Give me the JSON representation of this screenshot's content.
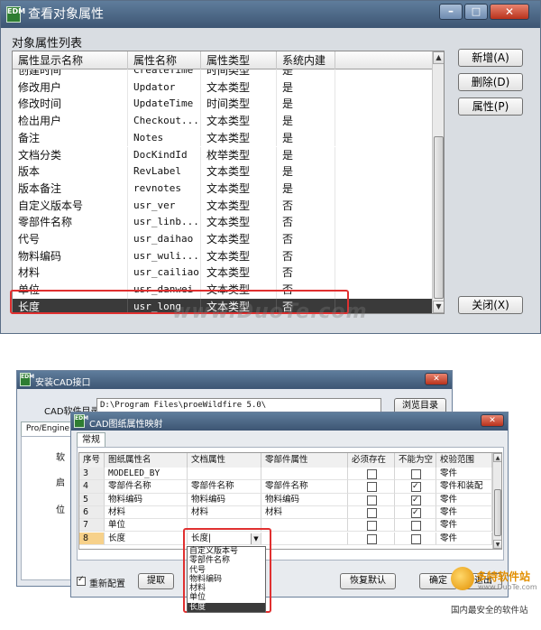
{
  "win1": {
    "logo": "EDM",
    "title": "查看对象属性",
    "list_label": "对象属性列表",
    "columns": [
      "属性显示名称",
      "属性名称",
      "属性类型",
      "系统内建"
    ],
    "rows": [
      [
        "创建时间",
        "CreateTime",
        "时间类型",
        "是"
      ],
      [
        "修改用户",
        "Updator",
        "文本类型",
        "是"
      ],
      [
        "修改时间",
        "UpdateTime",
        "时间类型",
        "是"
      ],
      [
        "检出用户",
        "Checkout...",
        "文本类型",
        "是"
      ],
      [
        "备注",
        "Notes",
        "文本类型",
        "是"
      ],
      [
        "文档分类",
        "DocKindId",
        "枚举类型",
        "是"
      ],
      [
        "版本",
        "RevLabel",
        "文本类型",
        "是"
      ],
      [
        "版本备注",
        "revnotes",
        "文本类型",
        "是"
      ],
      [
        "自定义版本号",
        "usr_ver",
        "文本类型",
        "否"
      ],
      [
        "零部件名称",
        "usr_linb...",
        "文本类型",
        "否"
      ],
      [
        "代号",
        "usr_daihao",
        "文本类型",
        "否"
      ],
      [
        "物料编码",
        "usr_wuli...",
        "文本类型",
        "否"
      ],
      [
        "材料",
        "usr_cailiao",
        "文本类型",
        "否"
      ],
      [
        "单位",
        "usr_danwei",
        "文本类型",
        "否"
      ],
      [
        "长度",
        "usr_long",
        "文本类型",
        "否"
      ]
    ],
    "selected_row": 14,
    "buttons": {
      "add": "新增(A)",
      "delete": "删除(D)",
      "props": "属性(P)",
      "close": "关闭(X)"
    },
    "watermark": "www.DuoTe.com"
  },
  "win2": {
    "logo": "EDM",
    "title": "安装CAD接口",
    "cad_dir_label": "CAD软件目录",
    "cad_dir_value": "D:\\Program Files\\proeWildfire 5.0\\",
    "browse_button": "浏览目录",
    "tab_partial": "Pro/Engine",
    "side_label_1": "软",
    "side_label_2": "启",
    "side_label_3": "位"
  },
  "win3": {
    "logo": "EDM",
    "title": "CAD图纸属性映射",
    "tab": "常规",
    "columns": [
      "序号",
      "图纸属性名",
      "文档属性",
      "零部件属性",
      "必须存在",
      "不能为空",
      "校验范围"
    ],
    "rows": [
      {
        "no": "3",
        "name": "MODELED_BY",
        "doc": "",
        "part": "",
        "must": false,
        "notnull": false,
        "range": "零件"
      },
      {
        "no": "4",
        "name": "零部件名称",
        "doc": "零部件名称",
        "part": "零部件名称",
        "must": false,
        "notnull": true,
        "range": "零件和装配"
      },
      {
        "no": "5",
        "name": "物料编码",
        "doc": "物料编码",
        "part": "物料编码",
        "must": false,
        "notnull": true,
        "range": "零件"
      },
      {
        "no": "6",
        "name": "材料",
        "doc": "材料",
        "part": "材料",
        "must": false,
        "notnull": true,
        "range": "零件"
      },
      {
        "no": "7",
        "name": "单位",
        "doc": "",
        "part": "",
        "must": false,
        "notnull": false,
        "range": "零件"
      },
      {
        "no": "8",
        "name": "长度",
        "doc": "长度|",
        "part": "",
        "must": false,
        "notnull": false,
        "range": "零件"
      }
    ],
    "dropdown_items": [
      "自定义版本号",
      "零部件名称",
      "代号",
      "物料编码",
      "材料",
      "单位",
      "长度"
    ],
    "dropdown_selected": 6,
    "checkbox_label": "重新配置",
    "extract_button": "提取",
    "restore_button": "恢复默认",
    "ok_button": "确定",
    "exit_button": "退出",
    "site_logo_text": "多特软件站",
    "site_url": "www.DuoTe.com",
    "site_slogan": "国内最安全的软件站"
  }
}
